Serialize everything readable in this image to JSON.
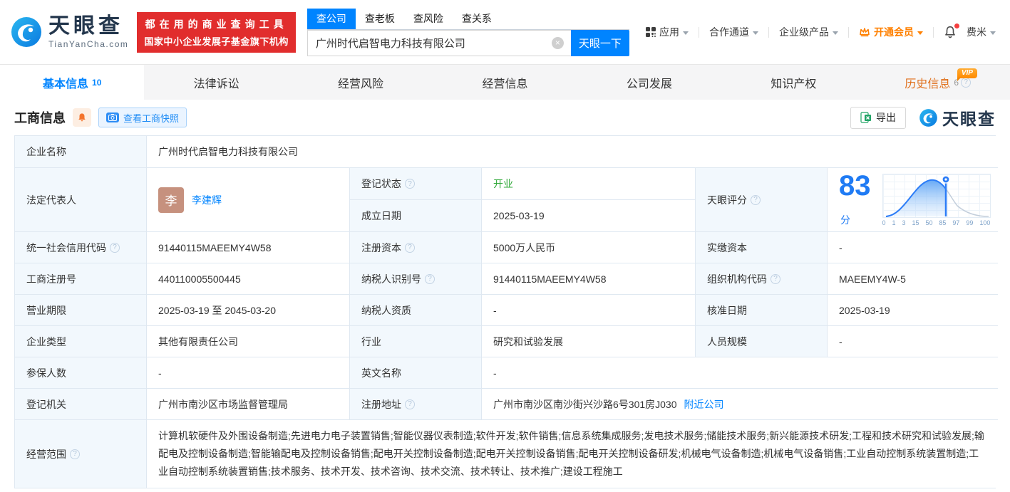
{
  "brand": {
    "name": "天眼查",
    "domain": "TianYanCha.com",
    "slogan1": "都在用的商业查询工具",
    "slogan2": "国家中小企业发展子基金旗下机构"
  },
  "search": {
    "tabs": [
      "查公司",
      "查老板",
      "查风险",
      "查关系"
    ],
    "value": "广州时代启智电力科技有限公司",
    "button": "天眼一下"
  },
  "topnav": {
    "apps": "应用",
    "partners": "合作通道",
    "enterprise": "企业级产品",
    "vip": "开通会员",
    "username": "费米"
  },
  "tabs": {
    "t1": "基本信息",
    "t1_count": "10",
    "t2": "法律诉讼",
    "t3": "经营风险",
    "t4": "经营信息",
    "t5": "公司发展",
    "t6": "知识产权",
    "t7": "历史信息",
    "t7_count": "6",
    "vip_badge": "VIP"
  },
  "section": {
    "title": "工商信息",
    "snapshot": "查看工商快照",
    "export": "导出",
    "brand": "天眼查"
  },
  "fields": {
    "name_label": "企业名称",
    "name_value": "广州时代启智电力科技有限公司",
    "legal_label": "法定代表人",
    "legal_avatar": "李",
    "legal_value": "李建辉",
    "status_label": "登记状态",
    "status_value": "开业",
    "established_label": "成立日期",
    "established_value": "2025-03-19",
    "score_label": "天眼评分",
    "score_value": "83",
    "score_unit": "分",
    "credit_label": "统一社会信用代码",
    "credit_value": "91440115MAEEMY4W58",
    "capital_label": "注册资本",
    "capital_value": "5000万人民币",
    "paid_label": "实缴资本",
    "paid_value": "-",
    "regno_label": "工商注册号",
    "regno_value": "440110005500445",
    "taxid_label": "纳税人识别号",
    "taxid_value": "91440115MAEEMY4W58",
    "orgcode_label": "组织机构代码",
    "orgcode_value": "MAEEMY4W-5",
    "term_label": "营业期限",
    "term_value": "2025-03-19 至 2045-03-20",
    "taxq_label": "纳税人资质",
    "taxq_value": "-",
    "approved_label": "核准日期",
    "approved_value": "2025-03-19",
    "type_label": "企业类型",
    "type_value": "其他有限责任公司",
    "industry_label": "行业",
    "industry_value": "研究和试验发展",
    "staff_label": "人员规模",
    "staff_value": "-",
    "insured_label": "参保人数",
    "insured_value": "-",
    "en_label": "英文名称",
    "en_value": "-",
    "authority_label": "登记机关",
    "authority_value": "广州市南沙区市场监督管理局",
    "address_label": "注册地址",
    "address_value": "广州市南沙区南沙街兴沙路6号301房J030",
    "address_link": "附近公司",
    "scope_label": "经营范围",
    "scope_value": "计算机软硬件及外围设备制造;先进电力电子装置销售;智能仪器仪表制造;软件开发;软件销售;信息系统集成服务;发电技术服务;储能技术服务;新兴能源技术研发;工程和技术研究和试验发展;输配电及控制设备制造;智能输配电及控制设备销售;配电开关控制设备制造;配电开关控制设备销售;配电开关控制设备研发;机械电气设备制造;机械电气设备销售;工业自动控制系统装置制造;工业自动控制系统装置销售;技术服务、技术开发、技术咨询、技术交流、技术转让、技术推广;建设工程施工"
  },
  "chart_data": {
    "type": "area",
    "title": "天眼评分分布曲线",
    "marker_value": 83,
    "x_ticks": [
      "0",
      "1",
      "3",
      "15",
      "50",
      "85",
      "97",
      "99",
      "100"
    ],
    "accent_color": "#1f7bf4"
  }
}
